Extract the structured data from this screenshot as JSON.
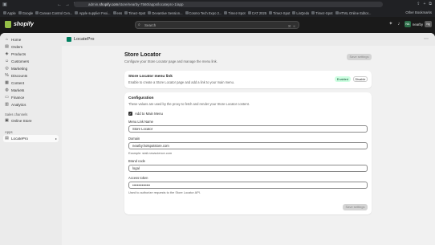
{
  "browser": {
    "url_prefix": "admin.",
    "url_host": "shopify.com",
    "url_path": "/store/nearby-7560/apps/locatepro-1/app",
    "bookmarks": [
      "Apple",
      "Google",
      "Canvas Control Cen...",
      "Apple supplier Fexi...",
      "ess",
      "Timez-Spot",
      "Devantive Session...",
      "Cosmo Tech Expo 2...",
      "Timez-Spot",
      "CAT 2025",
      "Timez-Spot",
      "LinQedo",
      "Timez-Spot",
      "HTML Online Editor..."
    ],
    "other_bookmarks": "Other Bookmarks"
  },
  "topbar": {
    "brand": "shopify",
    "search_placeholder": "Search",
    "search_shortcut": "⌘ K",
    "store_name": "nearby",
    "avatar_initials": "NA",
    "avatar2_initials": "Ng"
  },
  "sidebar": {
    "items": [
      {
        "label": "Home",
        "icon": "⌂"
      },
      {
        "label": "Orders",
        "icon": "▤"
      },
      {
        "label": "Products",
        "icon": "◈"
      },
      {
        "label": "Customers",
        "icon": "☺"
      },
      {
        "label": "Marketing",
        "icon": "◎"
      },
      {
        "label": "Discounts",
        "icon": "%"
      },
      {
        "label": "Content",
        "icon": "▦"
      },
      {
        "label": "Markets",
        "icon": "◍"
      },
      {
        "label": "Finance",
        "icon": "▭"
      },
      {
        "label": "Analytics",
        "icon": "▥"
      }
    ],
    "sales_channels_label": "Sales channels",
    "online_store": "Online Store",
    "apps_label": "Apps",
    "active_app": "LocatePro"
  },
  "app_header": {
    "title": "LocatePro"
  },
  "page": {
    "title": "Store Locator",
    "subtitle": "Configure your Store Locator page and manage the menu link.",
    "save_top": "Save settings",
    "menu_card": {
      "title": "Store Locator menu link",
      "description": "Enable to create a Store Locator page and add a link to your main menu.",
      "badge": "Enabled",
      "disable_button": "Disable"
    },
    "config_card": {
      "title": "Configuration",
      "description": "These values are used by the proxy to fetch and render your Store Locator content.",
      "add_to_menu_label": "Add to Main Menu",
      "menu_link_name_label": "Menu Link Name",
      "menu_link_name_value": "Store Locator",
      "domain_label": "Domain",
      "domain_value": "nearby.hotspotstore.com",
      "domain_help": "Example: stall.newscience.com",
      "brand_code_label": "Brand code",
      "brand_code_value": "logal",
      "access_token_label": "Access token",
      "access_token_value": "•••••••••••••••",
      "access_token_help": "Used to authorize requests to the Store Locator API.",
      "save_bottom": "Save settings"
    }
  },
  "colors": {
    "brand_green": "#95bf47",
    "enabled_badge_bg": "#cdfee1",
    "enabled_badge_text": "#0c5132"
  }
}
